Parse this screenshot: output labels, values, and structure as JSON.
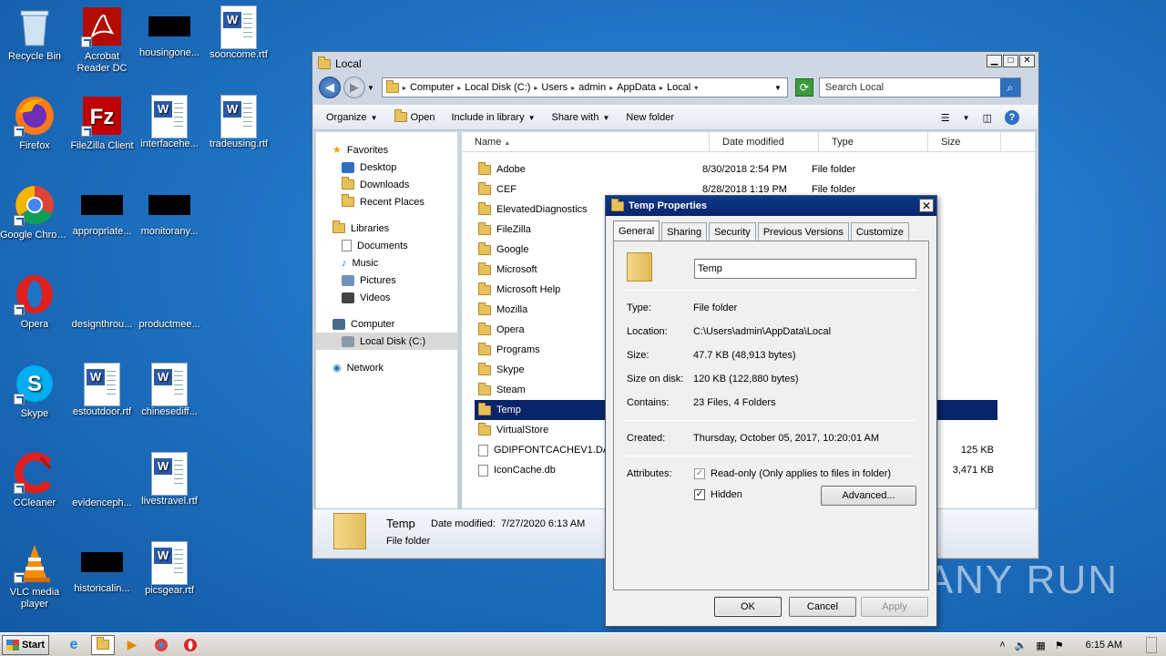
{
  "desktop": {
    "icons": [
      {
        "label": "Recycle Bin"
      },
      {
        "label": "Acrobat Reader DC"
      },
      {
        "label": "housingone..."
      },
      {
        "label": "sooncome.rtf"
      },
      {
        "label": "Firefox"
      },
      {
        "label": "FileZilla Client"
      },
      {
        "label": "interfacehe..."
      },
      {
        "label": "tradeusing.rtf"
      },
      {
        "label": "Google Chrome"
      },
      {
        "label": "appropriate..."
      },
      {
        "label": "monitorany..."
      },
      {
        "label": "Opera"
      },
      {
        "label": "designthrou..."
      },
      {
        "label": "productmee..."
      },
      {
        "label": "Skype"
      },
      {
        "label": "estoutdoor.rtf"
      },
      {
        "label": "chinesediff..."
      },
      {
        "label": "CCleaner"
      },
      {
        "label": "evidenceph..."
      },
      {
        "label": "livestravel.rtf"
      },
      {
        "label": "VLC media player"
      },
      {
        "label": "historicalin..."
      },
      {
        "label": "picsgear.rtf"
      }
    ],
    "watermark": "ANY RUN"
  },
  "explorer": {
    "title": "Local",
    "breadcrumb": [
      "Computer",
      "Local Disk (C:)",
      "Users",
      "admin",
      "AppData",
      "Local"
    ],
    "search_placeholder": "Search Local",
    "toolbar": {
      "organize": "Organize",
      "open": "Open",
      "include": "Include in library",
      "share": "Share with",
      "new_folder": "New folder"
    },
    "nav": {
      "favorites": "Favorites",
      "fav_items": [
        "Desktop",
        "Downloads",
        "Recent Places"
      ],
      "libraries": "Libraries",
      "lib_items": [
        "Documents",
        "Music",
        "Pictures",
        "Videos"
      ],
      "computer": "Computer",
      "local_disk": "Local Disk (C:)",
      "network": "Network"
    },
    "columns": {
      "name": "Name",
      "date": "Date modified",
      "type": "Type",
      "size": "Size"
    },
    "files": [
      {
        "name": "Adobe",
        "date": "8/30/2018 2:54 PM",
        "type": "File folder",
        "size": ""
      },
      {
        "name": "CEF",
        "date": "8/28/2018 1:19 PM",
        "type": "File folder",
        "size": ""
      },
      {
        "name": "ElevatedDiagnostics",
        "date": "",
        "type": "",
        "size": ""
      },
      {
        "name": "FileZilla",
        "date": "",
        "type": "",
        "size": ""
      },
      {
        "name": "Google",
        "date": "",
        "type": "",
        "size": ""
      },
      {
        "name": "Microsoft",
        "date": "",
        "type": "",
        "size": ""
      },
      {
        "name": "Microsoft Help",
        "date": "",
        "type": "",
        "size": ""
      },
      {
        "name": "Mozilla",
        "date": "",
        "type": "",
        "size": ""
      },
      {
        "name": "Opera",
        "date": "",
        "type": "",
        "size": ""
      },
      {
        "name": "Programs",
        "date": "",
        "type": "",
        "size": ""
      },
      {
        "name": "Skype",
        "date": "",
        "type": "",
        "size": ""
      },
      {
        "name": "Steam",
        "date": "",
        "type": "",
        "size": ""
      },
      {
        "name": "Temp",
        "date": "",
        "type": "",
        "size": ""
      },
      {
        "name": "VirtualStore",
        "date": "",
        "type": "",
        "size": ""
      },
      {
        "name": "GDIPFONTCACHEV1.DAT",
        "date": "",
        "type": "",
        "size": "125 KB"
      },
      {
        "name": "IconCache.db",
        "date": "",
        "type": "",
        "size": "3,471 KB"
      }
    ],
    "details": {
      "name": "Temp",
      "date_label": "Date modified:",
      "date_value": "7/27/2020 6:13 AM",
      "type": "File folder"
    }
  },
  "props": {
    "title": "Temp Properties",
    "tabs": [
      "General",
      "Sharing",
      "Security",
      "Previous Versions",
      "Customize"
    ],
    "name": "Temp",
    "rows": [
      {
        "k": "Type:",
        "v": "File folder"
      },
      {
        "k": "Location:",
        "v": "C:\\Users\\admin\\AppData\\Local"
      },
      {
        "k": "Size:",
        "v": "47.7 KB (48,913 bytes)"
      },
      {
        "k": "Size on disk:",
        "v": "120 KB (122,880 bytes)"
      },
      {
        "k": "Contains:",
        "v": "23 Files, 4 Folders"
      }
    ],
    "created_label": "Created:",
    "created_value": "Thursday, October 05, 2017, 10:20:01 AM",
    "attributes_label": "Attributes:",
    "readonly_label": "Read-only (Only applies to files in folder)",
    "hidden_label": "Hidden",
    "advanced": "Advanced...",
    "ok": "OK",
    "cancel": "Cancel",
    "apply": "Apply"
  },
  "taskbar": {
    "start": "Start",
    "clock": "6:15 AM"
  }
}
